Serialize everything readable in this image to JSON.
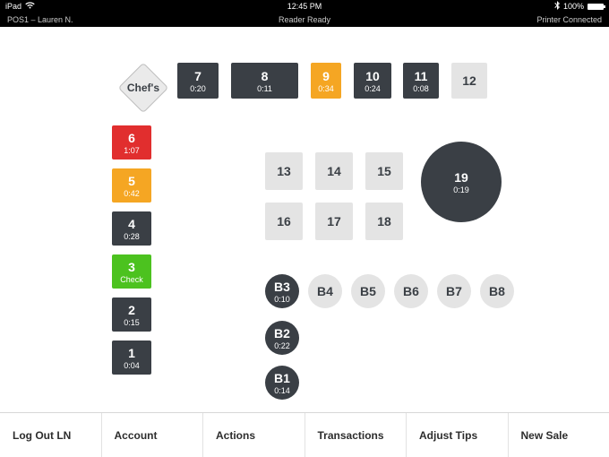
{
  "status": {
    "device": "iPad",
    "time": "12:45 PM",
    "battery": "100%"
  },
  "subbar": {
    "left": "POS1 – Lauren N.",
    "center": "Reader Ready",
    "right": "Printer Connected"
  },
  "chef": "Chef's",
  "topRow": [
    {
      "n": "7",
      "t": "0:20",
      "cls": "c-dark"
    },
    {
      "n": "8",
      "t": "0:11",
      "cls": "c-dark"
    },
    {
      "n": "9",
      "t": "0:34",
      "cls": "c-orange"
    },
    {
      "n": "10",
      "t": "0:24",
      "cls": "c-dark"
    },
    {
      "n": "11",
      "t": "0:08",
      "cls": "c-dark"
    },
    {
      "n": "12",
      "t": "",
      "cls": "c-light"
    }
  ],
  "leftCol": [
    {
      "n": "6",
      "t": "1:07",
      "cls": "c-red"
    },
    {
      "n": "5",
      "t": "0:42",
      "cls": "c-orange"
    },
    {
      "n": "4",
      "t": "0:28",
      "cls": "c-dark"
    },
    {
      "n": "3",
      "t": "Check",
      "cls": "c-green"
    },
    {
      "n": "2",
      "t": "0:15",
      "cls": "c-dark"
    },
    {
      "n": "1",
      "t": "0:04",
      "cls": "c-dark"
    }
  ],
  "midGrid": [
    {
      "n": "13"
    },
    {
      "n": "14"
    },
    {
      "n": "15"
    },
    {
      "n": "16"
    },
    {
      "n": "17"
    },
    {
      "n": "18"
    }
  ],
  "bigRound": {
    "n": "19",
    "t": "0:19"
  },
  "barSeats": [
    {
      "n": "B3",
      "t": "0:10",
      "cls": "c-dark"
    },
    {
      "n": "B4",
      "cls": "c-light"
    },
    {
      "n": "B5",
      "cls": "c-light"
    },
    {
      "n": "B6",
      "cls": "c-light"
    },
    {
      "n": "B7",
      "cls": "c-light"
    },
    {
      "n": "B8",
      "cls": "c-light"
    }
  ],
  "barLow": [
    {
      "n": "B2",
      "t": "0:22"
    },
    {
      "n": "B1",
      "t": "0:14"
    }
  ],
  "bottom": [
    "Log Out LN",
    "Account",
    "Actions",
    "Transactions",
    "Adjust Tips",
    "New Sale"
  ]
}
